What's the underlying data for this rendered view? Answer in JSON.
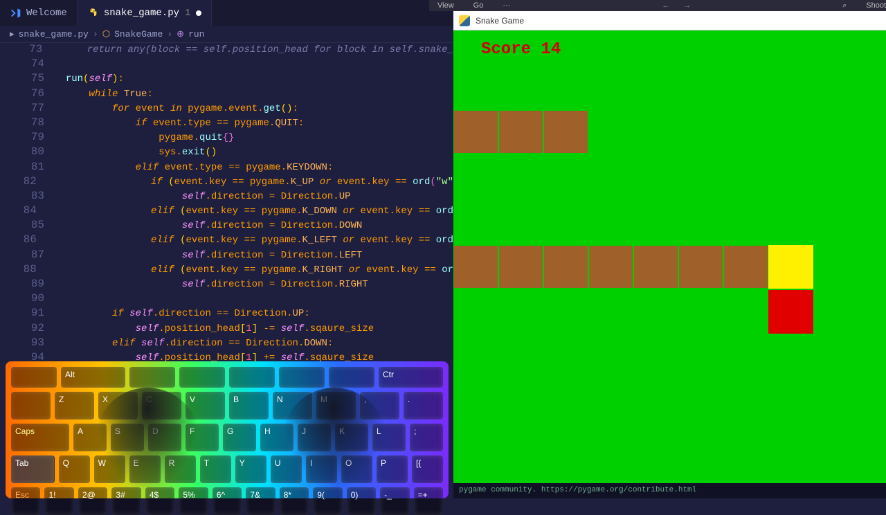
{
  "tabs": [
    {
      "icon": "vscode",
      "label": "Welcome",
      "active": false,
      "modified": false
    },
    {
      "icon": "python",
      "label": "snake_game.py",
      "suffix": "1",
      "active": true,
      "modified": true
    }
  ],
  "breadcrumb": {
    "file": "snake_game.py",
    "class": "SnakeGame",
    "method": "run"
  },
  "native_menu": {
    "view": "View",
    "go": "Go",
    "more": "···",
    "shoot": "Shoot"
  },
  "game": {
    "title": "Snake Game",
    "score_label": "Score",
    "score": 14,
    "cell": 65,
    "snake_segments": [
      {
        "col": 0,
        "row": 1
      },
      {
        "col": 1,
        "row": 1
      },
      {
        "col": 2,
        "row": 1
      },
      {
        "col": 0,
        "row": 4
      },
      {
        "col": 1,
        "row": 4
      },
      {
        "col": 2,
        "row": 4
      },
      {
        "col": 3,
        "row": 4
      },
      {
        "col": 4,
        "row": 4
      },
      {
        "col": 5,
        "row": 4
      },
      {
        "col": 6,
        "row": 4
      }
    ],
    "head": {
      "col": 7,
      "row": 4
    },
    "food": {
      "col": 7,
      "row": 5
    }
  },
  "console_text": "pygame community. https://pygame.org/contribute.html",
  "code": [
    {
      "n": 73,
      "seg": [
        [
          "cmt",
          "    return any(block == self.position_head for block in self.snake_"
        ]
      ]
    },
    {
      "n": 74,
      "seg": [
        [
          "op",
          ""
        ]
      ]
    },
    {
      "n": 75,
      "seg": [
        [
          "fn",
          "run"
        ],
        [
          "paren",
          "("
        ],
        [
          "self",
          "self"
        ],
        [
          "paren",
          ")"
        ],
        [
          "op",
          ":"
        ]
      ]
    },
    {
      "n": 76,
      "seg": [
        [
          "op",
          "    "
        ],
        [
          "kw",
          "while "
        ],
        [
          "const",
          "True"
        ],
        [
          "op",
          ":"
        ]
      ]
    },
    {
      "n": 77,
      "seg": [
        [
          "op",
          "        "
        ],
        [
          "kw",
          "for "
        ],
        [
          "op",
          "event "
        ],
        [
          "kw",
          "in "
        ],
        [
          "op",
          "pygame.event."
        ],
        [
          "fn",
          "get"
        ],
        [
          "paren",
          "()"
        ],
        [
          "op",
          ":"
        ]
      ]
    },
    {
      "n": 78,
      "seg": [
        [
          "op",
          "            "
        ],
        [
          "kw",
          "if "
        ],
        [
          "op",
          "event.type "
        ],
        [
          "op",
          "== "
        ],
        [
          "op",
          "pygame."
        ],
        [
          "const",
          "QUIT"
        ],
        [
          "op",
          ":"
        ]
      ]
    },
    {
      "n": 79,
      "seg": [
        [
          "op",
          "                pygame."
        ],
        [
          "fn",
          "quit"
        ],
        [
          "paren2",
          "{}"
        ]
      ]
    },
    {
      "n": 80,
      "seg": [
        [
          "op",
          "                sys."
        ],
        [
          "fn",
          "exit"
        ],
        [
          "paren",
          "()"
        ]
      ]
    },
    {
      "n": 81,
      "seg": [
        [
          "op",
          "            "
        ],
        [
          "kw",
          "elif "
        ],
        [
          "op",
          "event.type "
        ],
        [
          "op",
          "== "
        ],
        [
          "op",
          "pygame."
        ],
        [
          "const",
          "KEYDOWN"
        ],
        [
          "op",
          ":"
        ]
      ]
    },
    {
      "n": 82,
      "seg": [
        [
          "op",
          "                "
        ],
        [
          "kw",
          "if "
        ],
        [
          "paren",
          "("
        ],
        [
          "op",
          "event.key "
        ],
        [
          "op",
          "== "
        ],
        [
          "op",
          "pygame."
        ],
        [
          "const",
          "K_UP"
        ],
        [
          "kw2",
          " or "
        ],
        [
          "op",
          "event.key "
        ],
        [
          "op",
          "== "
        ],
        [
          "fn",
          "ord"
        ],
        [
          "paren2",
          "("
        ],
        [
          "str",
          "\"w\""
        ]
      ]
    },
    {
      "n": 83,
      "seg": [
        [
          "op",
          "                    "
        ],
        [
          "self",
          "self"
        ],
        [
          "op",
          ".direction "
        ],
        [
          "op",
          "= "
        ],
        [
          "op",
          "Direction."
        ],
        [
          "const",
          "UP"
        ]
      ]
    },
    {
      "n": 84,
      "seg": [
        [
          "op",
          "                "
        ],
        [
          "kw",
          "elif "
        ],
        [
          "paren",
          "("
        ],
        [
          "op",
          "event.key "
        ],
        [
          "op",
          "== "
        ],
        [
          "op",
          "pygame."
        ],
        [
          "const",
          "K_DOWN"
        ],
        [
          "kw2",
          " or "
        ],
        [
          "op",
          "event.key "
        ],
        [
          "op",
          "== "
        ],
        [
          "fn",
          "ord"
        ]
      ]
    },
    {
      "n": 85,
      "seg": [
        [
          "op",
          "                    "
        ],
        [
          "self",
          "self"
        ],
        [
          "op",
          ".direction "
        ],
        [
          "op",
          "= "
        ],
        [
          "op",
          "Direction."
        ],
        [
          "const",
          "DOWN"
        ]
      ]
    },
    {
      "n": 86,
      "seg": [
        [
          "op",
          "                "
        ],
        [
          "kw",
          "elif "
        ],
        [
          "paren",
          "("
        ],
        [
          "op",
          "event.key "
        ],
        [
          "op",
          "== "
        ],
        [
          "op",
          "pygame."
        ],
        [
          "const",
          "K_LEFT"
        ],
        [
          "kw2",
          " or "
        ],
        [
          "op",
          "event.key "
        ],
        [
          "op",
          "== "
        ],
        [
          "fn",
          "ord"
        ]
      ]
    },
    {
      "n": 87,
      "seg": [
        [
          "op",
          "                    "
        ],
        [
          "self",
          "self"
        ],
        [
          "op",
          ".direction "
        ],
        [
          "op",
          "= "
        ],
        [
          "op",
          "Direction."
        ],
        [
          "const",
          "LEFT"
        ]
      ]
    },
    {
      "n": 88,
      "seg": [
        [
          "op",
          "                "
        ],
        [
          "kw",
          "elif "
        ],
        [
          "paren",
          "("
        ],
        [
          "op",
          "event.key "
        ],
        [
          "op",
          "== "
        ],
        [
          "op",
          "pygame."
        ],
        [
          "const",
          "K_RIGHT"
        ],
        [
          "kw2",
          " or "
        ],
        [
          "op",
          "event.key "
        ],
        [
          "op",
          "== "
        ],
        [
          "fn",
          "or"
        ]
      ]
    },
    {
      "n": 89,
      "seg": [
        [
          "op",
          "                    "
        ],
        [
          "self",
          "self"
        ],
        [
          "op",
          ".direction "
        ],
        [
          "op",
          "= "
        ],
        [
          "op",
          "Direction."
        ],
        [
          "const",
          "RIGHT"
        ]
      ]
    },
    {
      "n": 90,
      "seg": [
        [
          "op",
          ""
        ]
      ]
    },
    {
      "n": 91,
      "seg": [
        [
          "op",
          "        "
        ],
        [
          "kw",
          "if "
        ],
        [
          "self",
          "self"
        ],
        [
          "op",
          ".direction "
        ],
        [
          "op",
          "== "
        ],
        [
          "op",
          "Direction."
        ],
        [
          "const",
          "UP"
        ],
        [
          "op",
          ":"
        ]
      ]
    },
    {
      "n": 92,
      "seg": [
        [
          "op",
          "            "
        ],
        [
          "self",
          "self"
        ],
        [
          "op",
          ".position_head"
        ],
        [
          "paren",
          "["
        ],
        [
          "num",
          "1"
        ],
        [
          "paren",
          "]"
        ],
        [
          "op",
          " -= "
        ],
        [
          "self",
          "self"
        ],
        [
          "op",
          ".sqaure_size"
        ]
      ]
    },
    {
      "n": 93,
      "seg": [
        [
          "op",
          "        "
        ],
        [
          "kw",
          "elif "
        ],
        [
          "self",
          "self"
        ],
        [
          "op",
          ".direction "
        ],
        [
          "op",
          "== "
        ],
        [
          "op",
          "Direction."
        ],
        [
          "const",
          "DOWN"
        ],
        [
          "op",
          ":"
        ]
      ]
    },
    {
      "n": 94,
      "seg": [
        [
          "op",
          "            "
        ],
        [
          "self",
          "self"
        ],
        [
          "op",
          ".position_head"
        ],
        [
          "paren",
          "["
        ],
        [
          "num",
          "1"
        ],
        [
          "paren",
          "]"
        ],
        [
          "op",
          " += "
        ],
        [
          "self",
          "self"
        ],
        [
          "op",
          ".sqaure_size"
        ]
      ]
    }
  ],
  "keyboard": {
    "row1": [
      "Esc",
      "1!",
      "2@",
      "3#",
      "4$",
      "5%",
      "6^",
      "7&",
      "8*",
      "9(",
      "0)",
      "-_",
      "=+"
    ],
    "row2": [
      "Tab",
      "Q",
      "W",
      "E",
      "R",
      "T",
      "Y",
      "U",
      "I",
      "O",
      "P",
      "[{"
    ],
    "row3": [
      "Caps",
      "A",
      "S",
      "D",
      "F",
      "G",
      "H",
      "J",
      "K",
      "L",
      ";"
    ],
    "row4": [
      "",
      "Z",
      "X",
      "C",
      "V",
      "B",
      "N",
      "M",
      ",",
      "."
    ],
    "row5": [
      "",
      "Alt",
      "",
      "",
      "",
      "",
      "",
      "Ctr"
    ]
  }
}
